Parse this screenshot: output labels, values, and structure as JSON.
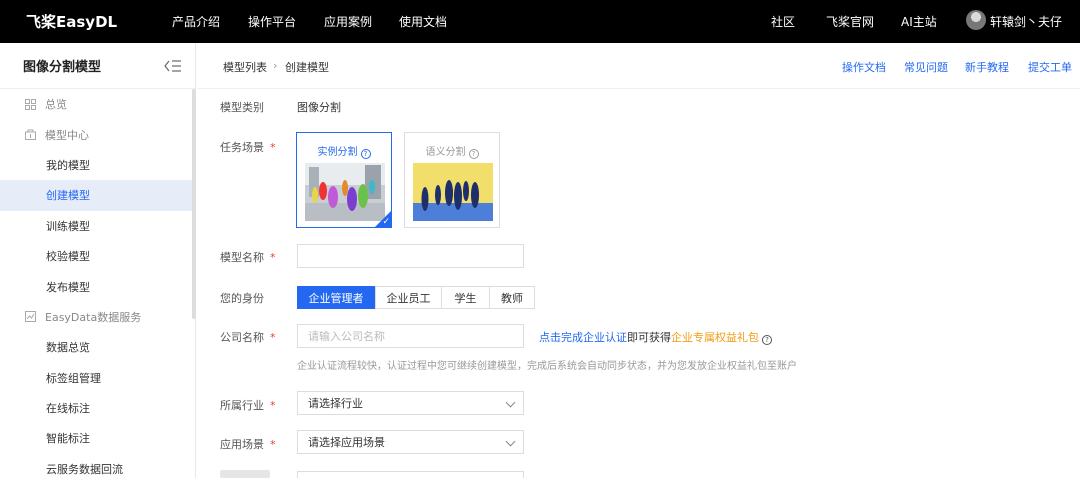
{
  "topnav": {
    "logo_mark": "飞桨",
    "logo_text": "飞桨EasyDL",
    "items": [
      "产品介绍",
      "操作平台",
      "应用案例",
      "使用文档"
    ],
    "right_items": [
      "社区",
      "飞桨官网",
      "AI主站"
    ],
    "username": "轩辕剑丶夫仔"
  },
  "sidebar": {
    "title": "图像分割模型",
    "items": [
      {
        "label": "总览",
        "kind": "group",
        "icon": "grid-icon"
      },
      {
        "label": "模型中心",
        "kind": "group",
        "icon": "model-icon"
      },
      {
        "label": "我的模型",
        "kind": "sub"
      },
      {
        "label": "创建模型",
        "kind": "sub",
        "active": true
      },
      {
        "label": "训练模型",
        "kind": "sub"
      },
      {
        "label": "校验模型",
        "kind": "sub"
      },
      {
        "label": "发布模型",
        "kind": "sub"
      },
      {
        "label": "EasyData数据服务",
        "kind": "group",
        "icon": "data-icon"
      },
      {
        "label": "数据总览",
        "kind": "sub"
      },
      {
        "label": "标签组管理",
        "kind": "sub"
      },
      {
        "label": "在线标注",
        "kind": "sub"
      },
      {
        "label": "智能标注",
        "kind": "sub"
      },
      {
        "label": "云服务数据回流",
        "kind": "sub"
      }
    ]
  },
  "breadcrumb": {
    "parent": "模型列表",
    "current": "创建模型"
  },
  "help_links": [
    "操作文档",
    "常见问题",
    "新手教程",
    "提交工单"
  ],
  "form": {
    "model_category": {
      "label": "模型类别",
      "value": "图像分割"
    },
    "task_scene": {
      "label": "任务场景",
      "cards": [
        {
          "title": "实例分割",
          "selected": true
        },
        {
          "title": "语义分割",
          "selected": false
        }
      ]
    },
    "model_name": {
      "label": "模型名称",
      "value": "",
      "placeholder": ""
    },
    "identity": {
      "label": "您的身份",
      "options": [
        "企业管理者",
        "企业员工",
        "学生",
        "教师"
      ],
      "selected": "企业管理者"
    },
    "company_name": {
      "label": "公司名称",
      "placeholder": "请输入公司名称",
      "link_prefix": "点击完成企业认证",
      "link_middle": "即可获得",
      "link_gift": "企业专属权益礼包",
      "note": "企业认证流程较快，认证过程中您可继续创建模型，完成后系统会自动同步状态，并为您发放企业权益礼包至账户"
    },
    "industry": {
      "label": "所属行业",
      "placeholder": "请选择行业"
    },
    "app_scene": {
      "label": "应用场景",
      "placeholder": "请选择应用场景"
    },
    "required_mark": "*"
  },
  "colors": {
    "accent": "#2468f2",
    "required": "#e8412c",
    "gift": "#f39c12",
    "topbar": "#000000"
  }
}
